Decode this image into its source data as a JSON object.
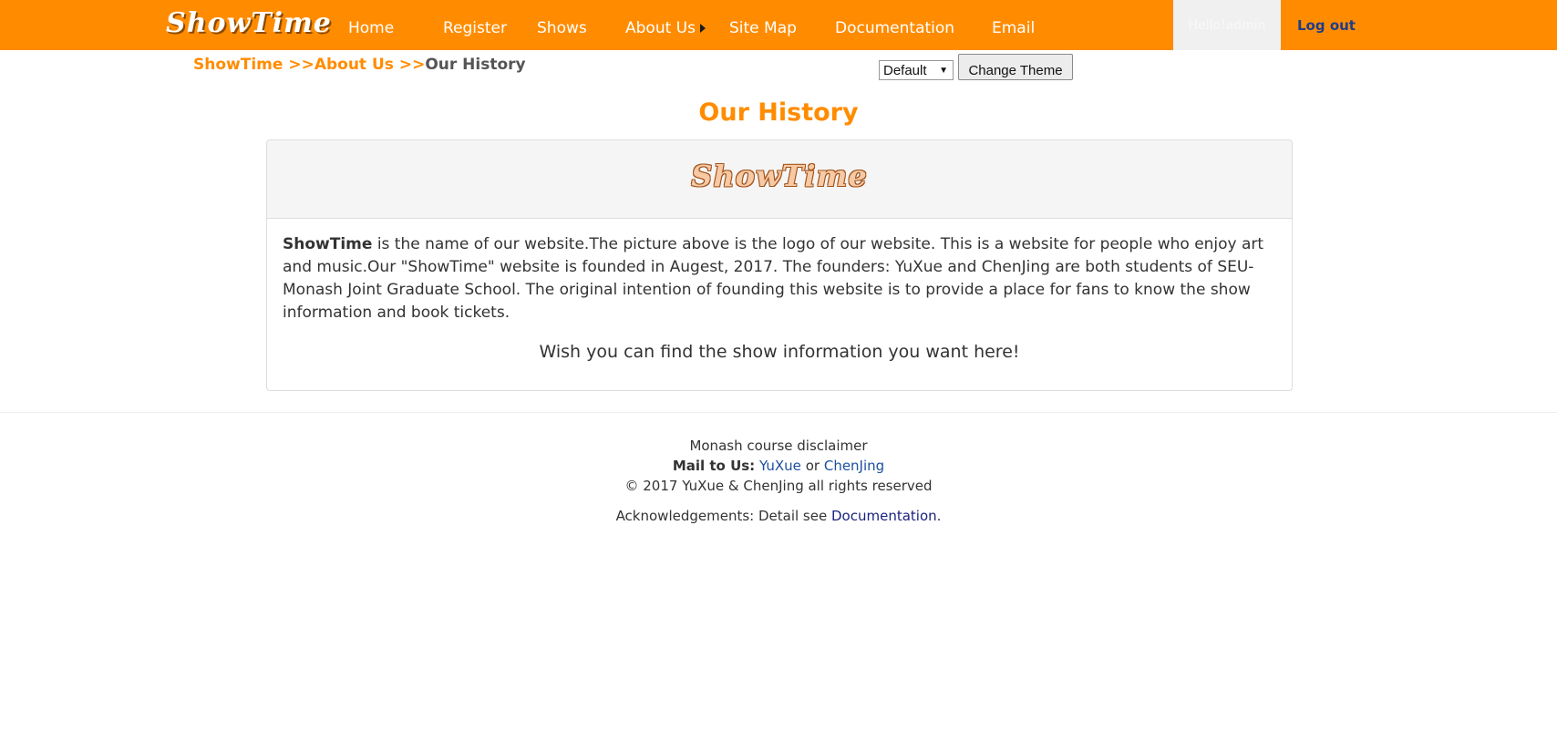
{
  "brand": {
    "logo_text": "ShowTime",
    "accent": "#ff8c00"
  },
  "nav": {
    "items": [
      {
        "label": "Home"
      },
      {
        "label": "Register"
      },
      {
        "label": "Shows"
      },
      {
        "label": "About Us",
        "has_submenu": true
      },
      {
        "label": "Site Map"
      },
      {
        "label": "Documentation"
      },
      {
        "label": "Email"
      }
    ],
    "greeting": "Hello!admin",
    "logout": "Log out"
  },
  "breadcrumb": {
    "items": [
      "ShowTime",
      "About Us",
      "Our History"
    ],
    "separator": ">>"
  },
  "theme": {
    "selected": "Default",
    "button": "Change Theme"
  },
  "page": {
    "title": "Our History",
    "panel_logo": "ShowTime",
    "intro_bold": "ShowTime",
    "intro_text": " is the name of our website.The picture above is the logo of our website. This is a website for people who enjoy art and music.Our \"ShowTime\" website is founded in Augest, 2017. The founders: YuXue and ChenJing are both students of SEU-Monash Joint Graduate School. The original intention of founding this website is to provide a place for fans to know the show information and book tickets.",
    "wish": "Wish you can find the show information you want here!"
  },
  "footer": {
    "disclaimer": "Monash course disclaimer",
    "mail_label": "Mail to Us:",
    "mail_link_1": "YuXue",
    "mail_or": "or",
    "mail_link_2": "ChenJing",
    "copyright": "© 2017 YuXue & ChenJing all rights reserved",
    "ack_prefix": "Acknowledgements: Detail see",
    "ack_link": "Documentation",
    "ack_suffix": "."
  }
}
